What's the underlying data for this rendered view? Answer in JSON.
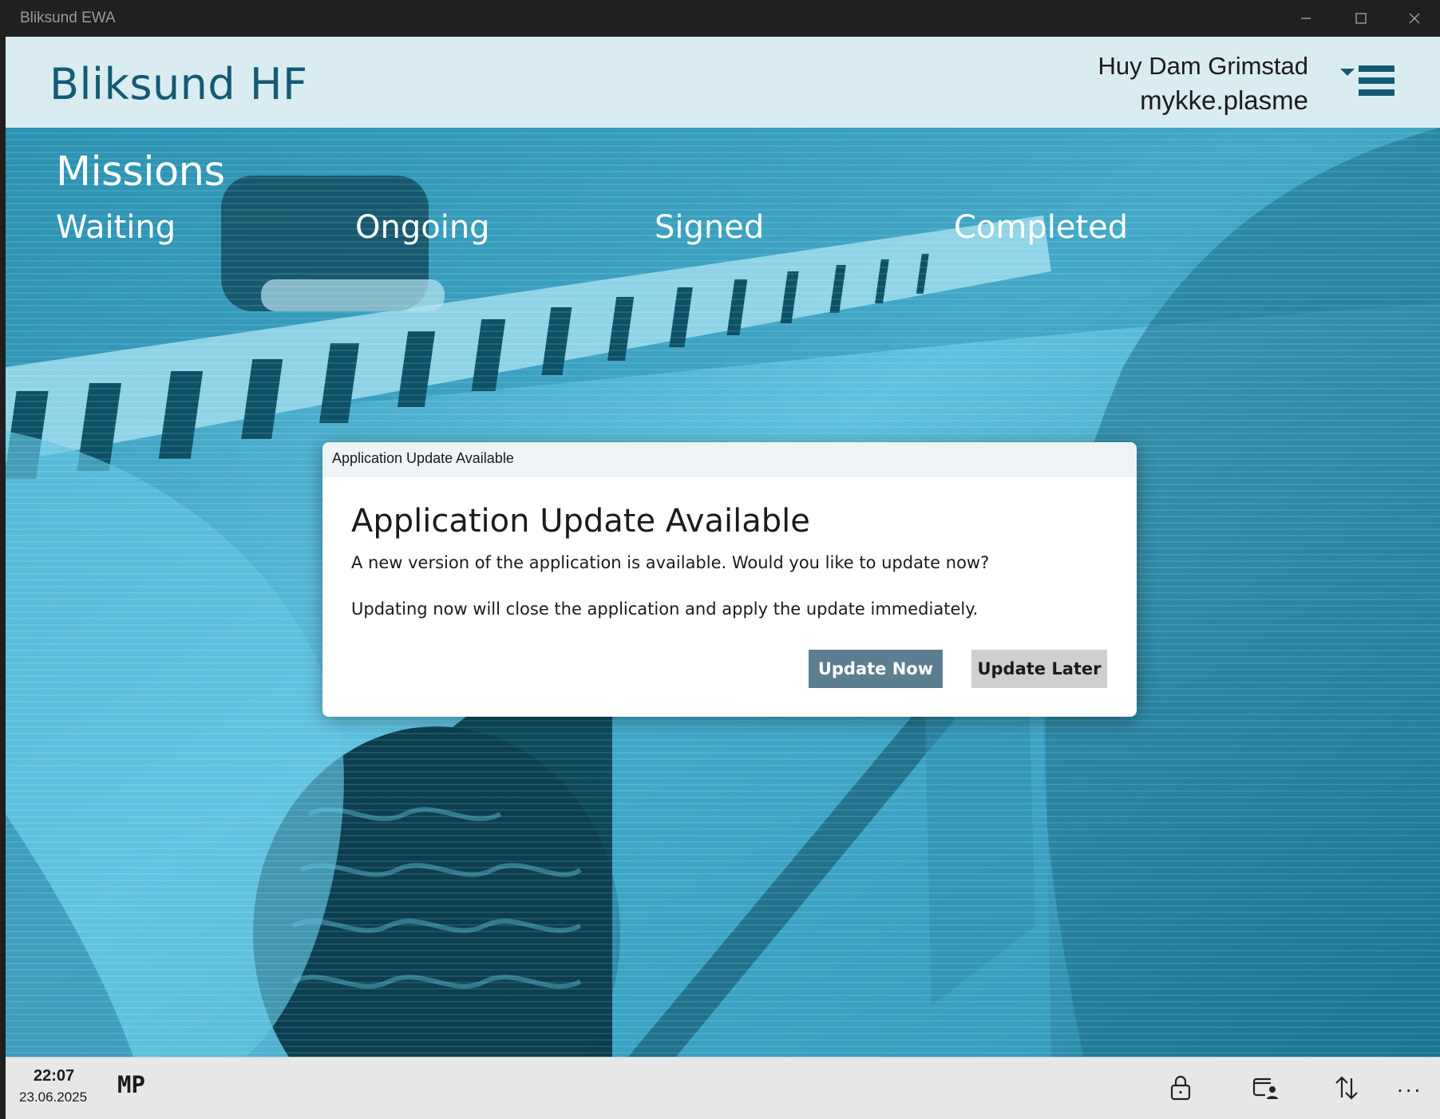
{
  "window": {
    "title": "Bliksund EWA",
    "minimize_icon": "minimize-icon",
    "maximize_icon": "maximize-icon",
    "close_icon": "close-icon"
  },
  "header": {
    "brand": "Bliksund HF",
    "user_name": "Huy Dam Grimstad",
    "user_login": "mykke.plasme",
    "menu_icon": "hamburger-menu-icon"
  },
  "missions": {
    "title": "Missions",
    "tabs": [
      "Waiting",
      "Ongoing",
      "Signed",
      "Completed"
    ]
  },
  "dialog": {
    "window_title": "Application Update Available",
    "heading": "Application Update Available",
    "message": "A new version of the application is available. Would you like to update now?",
    "detail": "Updating now will close the application and apply the update immediately.",
    "primary_button": "Update Now",
    "secondary_button": "Update Later"
  },
  "statusbar": {
    "time": "22:07",
    "date": "23.06.2025",
    "initials": "MP",
    "more": "...",
    "icons": [
      "lock-icon",
      "device-user-icon",
      "sync-arrows-icon"
    ]
  },
  "colors": {
    "header_bg": "#d9ecf2",
    "brand": "#145a72",
    "primary_button": "#5b7e91",
    "secondary_button": "#cfcfcf",
    "background_tint": "#1e9bbf"
  }
}
